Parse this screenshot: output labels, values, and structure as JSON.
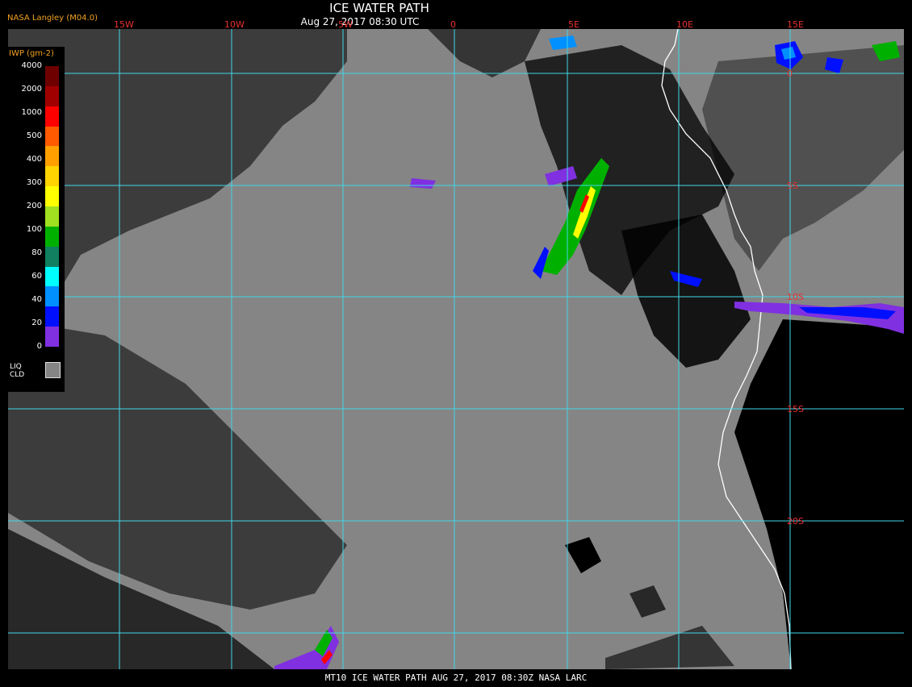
{
  "header": {
    "title": "ICE WATER PATH",
    "subtitle": "Aug 27, 2017 08:30 UTC",
    "provider": "NASA Langley (M04.0)"
  },
  "legend": {
    "title": "IWP (gm-2)",
    "ticks": [
      "4000",
      "2000",
      "1000",
      "500",
      "400",
      "300",
      "200",
      "100",
      "80",
      "60",
      "40",
      "20",
      "0"
    ],
    "colors": [
      "#6e0000",
      "#a00000",
      "#ff0000",
      "#ff5a00",
      "#ffa000",
      "#ffd400",
      "#ffff00",
      "#a0e020",
      "#00b000",
      "#108060",
      "#00ffff",
      "#0090ff",
      "#0010ff",
      "#8030e0"
    ],
    "liq_label_1": "LIQ",
    "liq_label_2": "CLD",
    "liq_color": "#858585"
  },
  "map": {
    "graticule_color": "#40d8e8",
    "land_color": "#000000",
    "liquid_cloud_color": "#858585",
    "coastline_color": "#ffffff",
    "lon_labels": [
      "15W",
      "10W",
      "5W",
      "0",
      "5E",
      "10E",
      "15E"
    ],
    "lat_labels": [
      "0",
      "5S",
      "10S",
      "15S",
      "20S"
    ]
  },
  "footer": {
    "text": "MT10  ICE WATER PATH   AUG 27, 2017 08:30Z   NASA LARC"
  }
}
